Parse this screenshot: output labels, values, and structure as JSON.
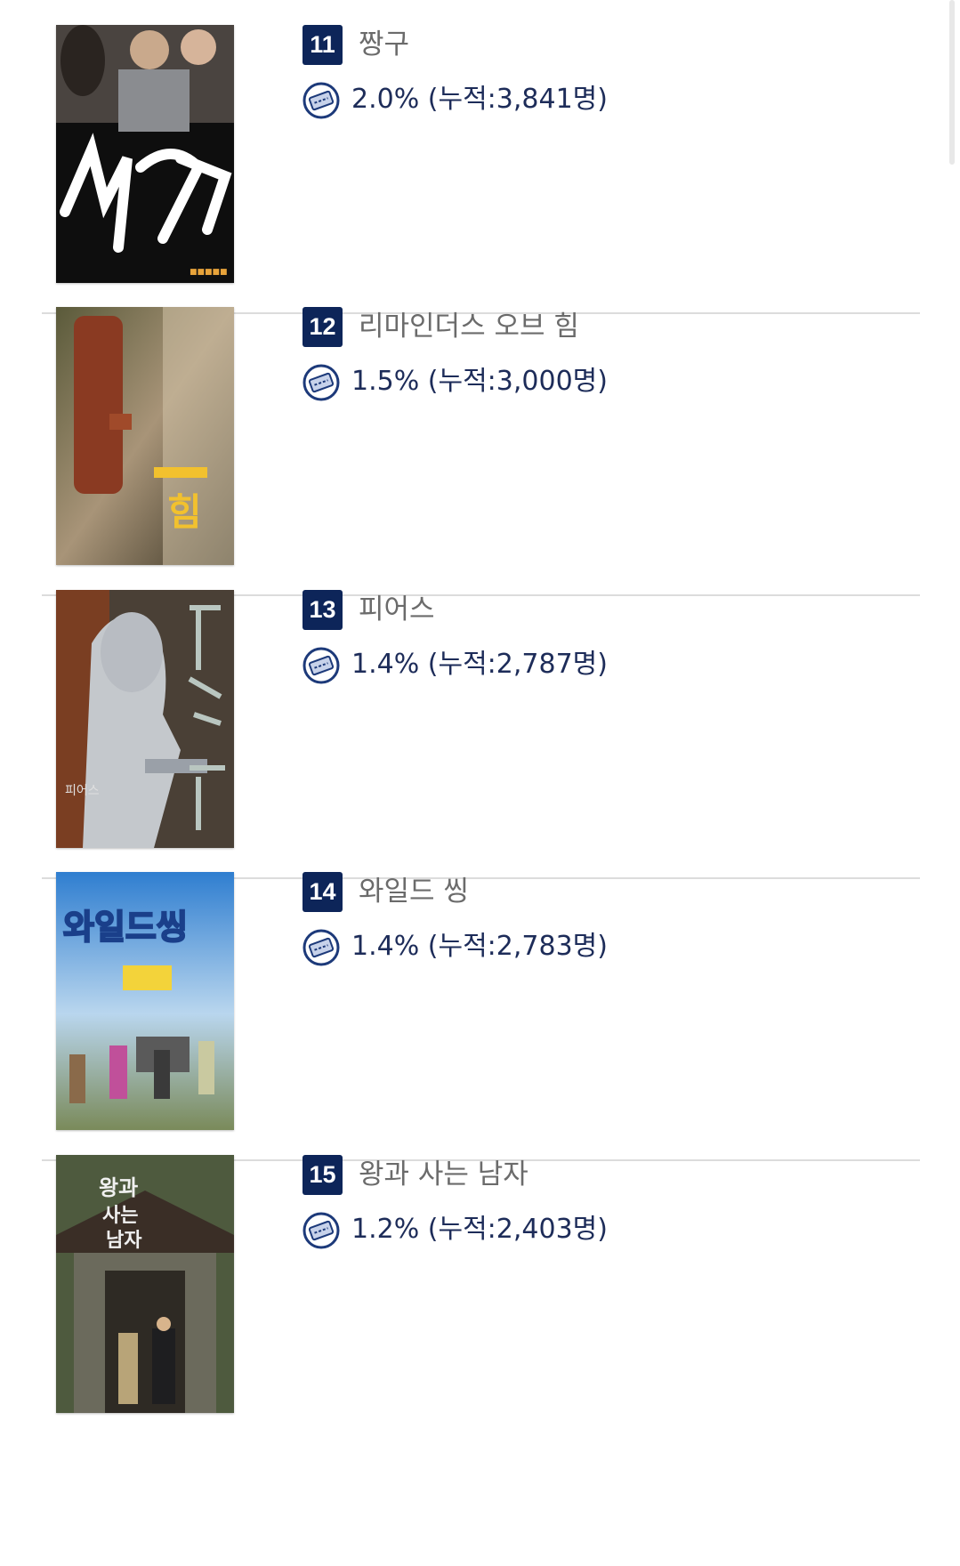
{
  "items": [
    {
      "rank": "11",
      "title": "짱구",
      "share": "2.0%",
      "cumulative": "(누적:3,841명)",
      "poster_text": "짱구",
      "poster_icon": "movie-poster-icon"
    },
    {
      "rank": "12",
      "title": "리마인더스 오브 힘",
      "share": "1.5%",
      "cumulative": "(누적:3,000명)",
      "poster_text": "힘",
      "poster_icon": "movie-poster-icon"
    },
    {
      "rank": "13",
      "title": "피어스",
      "share": "1.4%",
      "cumulative": "(누적:2,787명)",
      "poster_text": "피어스",
      "poster_icon": "movie-poster-icon"
    },
    {
      "rank": "14",
      "title": "와일드 씽",
      "share": "1.4%",
      "cumulative": "(누적:2,783명)",
      "poster_text": "와일드씽",
      "poster_icon": "movie-poster-icon"
    },
    {
      "rank": "15",
      "title": "왕과 사는 남자",
      "share": "1.2%",
      "cumulative": "(누적:2,403명)",
      "poster_text": "왕과사는남자",
      "poster_icon": "movie-poster-icon"
    }
  ],
  "colors": {
    "rank_badge": "#0d2559",
    "stat_text": "#1d2c59",
    "title_text": "#6b6b6b",
    "divider": "#dcdcdc"
  }
}
